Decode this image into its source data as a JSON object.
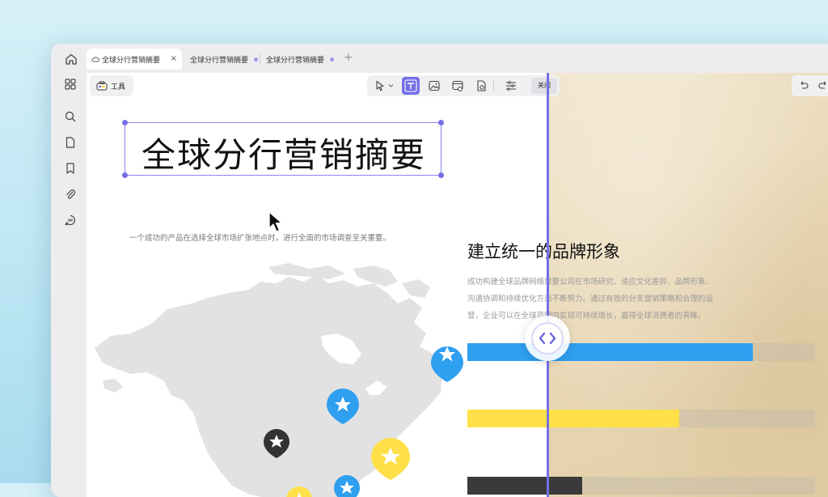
{
  "tabs": [
    {
      "label": "全球分行营销摘要",
      "active": true
    },
    {
      "label": "全球分行营销摘要",
      "active": false
    },
    {
      "label": "全球分行营销摘要",
      "active": false
    }
  ],
  "tab_close": "×",
  "new_tab": "+",
  "toolbar": {
    "tools_label": "工具",
    "close_label": "关闭"
  },
  "document": {
    "title": "全球分行营销摘要",
    "subtitle": "一个成功的产品在选择全球市场扩张地点时，进行全面的市场调查至关重要。"
  },
  "brand_section": {
    "title": "建立统一的品牌形象",
    "body_lines": [
      "成功构建全球品牌网络需要公司在市场研究、适应文化差异、品牌形象、",
      "沟通协调和持续优化方面不断努力。通过有效的分支营销策略和合理的运",
      "营，企业可以在全球范围内实现可持续增长，赢得全球消费者的青睐。"
    ]
  },
  "progress_bars": [
    {
      "color": "#2f9ff0",
      "fraction": 0.82
    },
    {
      "color": "#ffe048",
      "fraction": 0.61
    },
    {
      "color": "#3a3a3a",
      "fraction": 0.33
    }
  ],
  "map_markers": [
    {
      "color": "#2f9ff0",
      "icon": "star-icon"
    },
    {
      "color": "#2f9ff0",
      "icon": "star-icon"
    },
    {
      "color": "#333333",
      "icon": "star-icon"
    },
    {
      "color": "#ffe048",
      "icon": "star-icon"
    },
    {
      "color": "#2f9ff0",
      "icon": "star-icon"
    },
    {
      "color": "#ffe048",
      "icon": "star-icon"
    }
  ],
  "accent_color": "#7570e8"
}
